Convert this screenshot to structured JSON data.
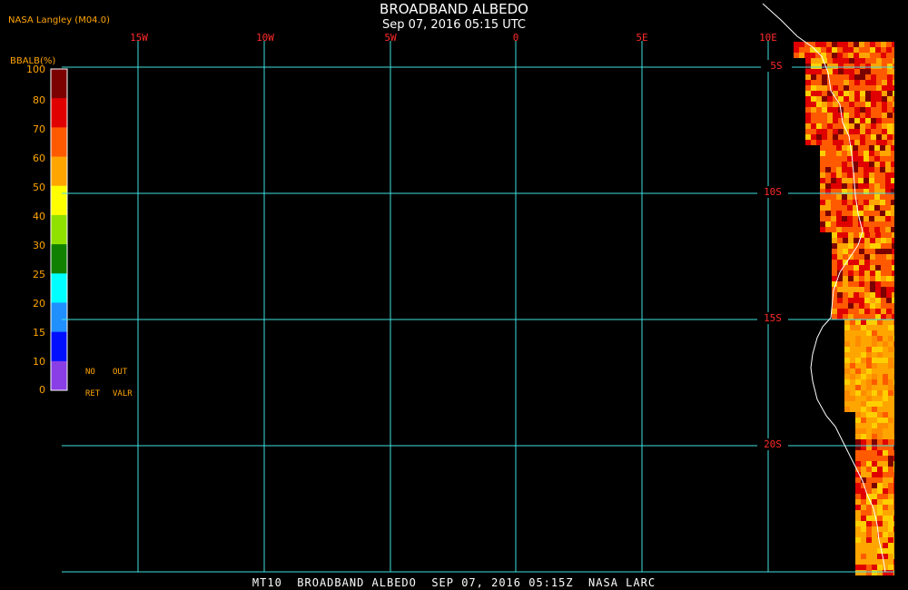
{
  "header": {
    "title": "BROADBAND ALBEDO",
    "subtitle": "Sep 07, 2016 05:15 UTC",
    "agency": "NASA Langley (M04.0)"
  },
  "colorbar": {
    "title": "BBALB(%)",
    "ticks": [
      "100",
      "80",
      "70",
      "60",
      "50",
      "40",
      "30",
      "25",
      "20",
      "15",
      "10",
      "0"
    ],
    "colors": [
      "#7b0000",
      "#e00000",
      "#ff5a00",
      "#ffa500",
      "#ffff00",
      "#90e000",
      "#108000",
      "#00ffff",
      "#2090ff",
      "#0010ff",
      "#8a3ee6"
    ],
    "note_line1": [
      "NO",
      "OUT"
    ],
    "note_line2": [
      "RET",
      "VALR"
    ]
  },
  "map": {
    "lon_labels": [
      "15W",
      "10W",
      "5W",
      "0",
      "5E",
      "10E"
    ],
    "lat_labels": [
      "5S",
      "10S",
      "15S",
      "20S"
    ],
    "grid_color": "#40e0e0",
    "coast_color": "#ffffff"
  },
  "footer": {
    "text": "MT10  BROADBAND ALBEDO  SEP 07, 2016 05:15Z  NASA LARC"
  }
}
